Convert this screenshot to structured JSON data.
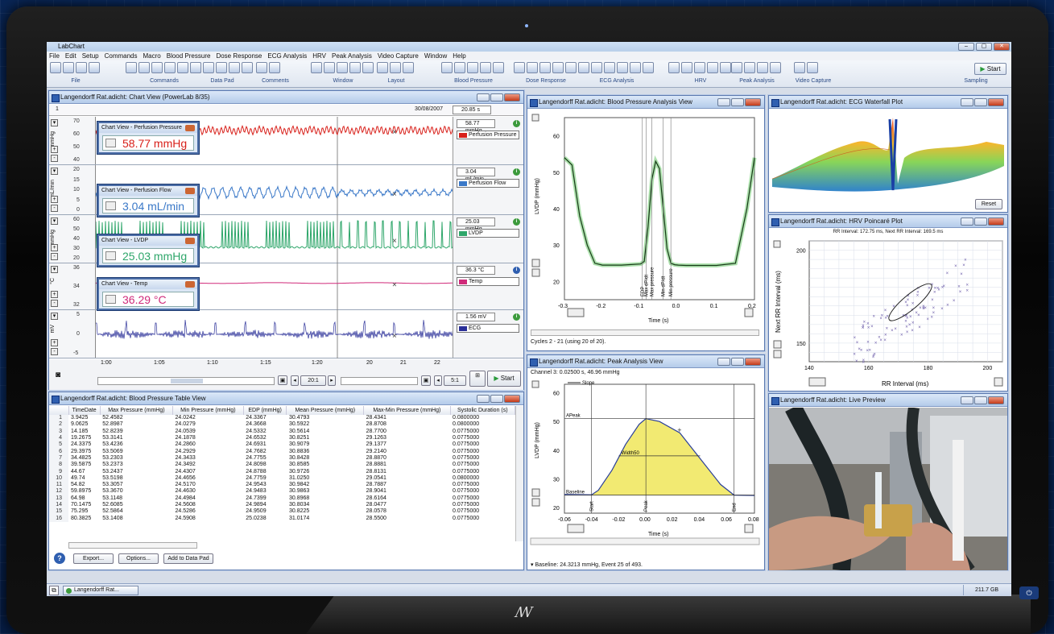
{
  "app": {
    "title": "LabChart"
  },
  "menu": [
    "File",
    "Edit",
    "Setup",
    "Commands",
    "Macro",
    "Blood Pressure",
    "Dose Response",
    "ECG Analysis",
    "HRV",
    "Peak Analysis",
    "Video Capture",
    "Window",
    "Help"
  ],
  "toolbar_groups": [
    "File",
    "Commands",
    "Data Pad",
    "Comments",
    "Window",
    "Layout",
    "Blood Pressure",
    "Dose Response",
    "ECG Analysis",
    "HRV",
    "Peak Analysis",
    "Video Capture",
    "Sampling"
  ],
  "toolbar_start": "Start",
  "chart_view": {
    "title": "Langendorff Rat.adicht: Chart View (PowerLab 8/35)",
    "comment_marker": "1",
    "date": "30/08/2007",
    "duration": "20.85 s",
    "time_ticks": [
      "1:00",
      "1:05",
      "1:10",
      "1:15",
      "1:20",
      "20",
      "21",
      "22"
    ],
    "zoom1": "20:1",
    "zoom2": "5:1",
    "start": "Start",
    "channels": [
      {
        "name": "Perfusion Pressure",
        "unit": "mmHg",
        "value": "58.77 mmHg",
        "color": "#d8201a",
        "ticks": [
          "70",
          "60",
          "50",
          "40"
        ],
        "popup_title": "Chart View - Perfusion Pressure",
        "popup_value": "58.77 mmHg"
      },
      {
        "name": "Perfusion Flow",
        "unit": "mL/min",
        "value": "3.04 mL/min",
        "color": "#3a78c8",
        "ticks": [
          "20",
          "15",
          "10",
          "5",
          "0"
        ],
        "popup_title": "Chart View - Perfusion Flow",
        "popup_value": "3.04 mL/min"
      },
      {
        "name": "LVDP",
        "unit": "mmHg",
        "value": "25.03 mmHg",
        "color": "#2ea66a",
        "ticks": [
          "60",
          "50",
          "40",
          "30",
          "20"
        ],
        "popup_title": "Chart View - LVDP",
        "popup_value": "25.03 mmHg"
      },
      {
        "name": "Temp",
        "unit": "°C",
        "value": "36.3 °C",
        "color": "#d02a7a",
        "ticks": [
          "36",
          "34",
          "32"
        ],
        "popup_title": "Chart View - Temp",
        "popup_value": "36.29 °C"
      },
      {
        "name": "ECG",
        "unit": "mV",
        "value": "1.56 mV",
        "color": "#2a2f98",
        "ticks": [
          "5",
          "0",
          "-5"
        ]
      }
    ]
  },
  "bp_table": {
    "title": "Langendorff Rat.adicht: Blood Pressure Table View",
    "columns": [
      "TimeDate",
      "Max Pressure (mmHg)",
      "Min Pressure (mmHg)",
      "EDP (mmHg)",
      "Mean Pressure (mmHg)",
      "Max-Min Pressure (mmHg)",
      "Systolic Duration (s)"
    ],
    "rows": [
      [
        "1",
        "3.9425",
        "52.4582",
        "24.0242",
        "24.3367",
        "30.4793",
        "28.4341",
        "0.0800000"
      ],
      [
        "2",
        "9.0625",
        "52.8987",
        "24.0279",
        "24.3668",
        "30.5922",
        "28.8708",
        "0.0800000"
      ],
      [
        "3",
        "14.185",
        "52.8239",
        "24.0539",
        "24.5332",
        "30.5614",
        "28.7700",
        "0.0775000"
      ],
      [
        "4",
        "19.2675",
        "53.3141",
        "24.1878",
        "24.6532",
        "30.8251",
        "29.1263",
        "0.0775000"
      ],
      [
        "5",
        "24.3375",
        "53.4236",
        "24.2860",
        "24.6931",
        "30.9079",
        "29.1377",
        "0.0775000"
      ],
      [
        "6",
        "29.3975",
        "53.5069",
        "24.2929",
        "24.7682",
        "30.8836",
        "29.2140",
        "0.0775000"
      ],
      [
        "7",
        "34.4825",
        "53.2303",
        "24.3433",
        "24.7755",
        "30.8428",
        "28.8870",
        "0.0775000"
      ],
      [
        "8",
        "39.5875",
        "53.2373",
        "24.3492",
        "24.8098",
        "30.8585",
        "28.8881",
        "0.0775000"
      ],
      [
        "9",
        "44.67",
        "53.2437",
        "24.4307",
        "24.8788",
        "30.9726",
        "28.8131",
        "0.0775000"
      ],
      [
        "10",
        "49.74",
        "53.5198",
        "24.4656",
        "24.7759",
        "31.0250",
        "29.0541",
        "0.0800000"
      ],
      [
        "11",
        "54.82",
        "53.3057",
        "24.5170",
        "24.9543",
        "30.9842",
        "28.7887",
        "0.0775000"
      ],
      [
        "12",
        "59.8975",
        "53.3670",
        "24.4630",
        "24.9483",
        "30.9863",
        "28.9041",
        "0.0775000"
      ],
      [
        "13",
        "64.98",
        "53.1148",
        "24.4984",
        "24.7399",
        "30.8968",
        "28.6164",
        "0.0775000"
      ],
      [
        "14",
        "70.1475",
        "52.6085",
        "24.5608",
        "24.9894",
        "30.8034",
        "28.0477",
        "0.0775000"
      ],
      [
        "15",
        "75.295",
        "52.5864",
        "24.5286",
        "24.9509",
        "30.8225",
        "28.0578",
        "0.0775000"
      ],
      [
        "16",
        "80.3825",
        "53.1408",
        "24.5908",
        "25.0238",
        "31.0174",
        "28.5500",
        "0.0775000"
      ]
    ],
    "buttons": [
      "Export...",
      "Options...",
      "Add to Data Pad"
    ]
  },
  "bp_analysis": {
    "title": "Langendorff Rat.adicht: Blood Pressure Analysis View",
    "ylabel": "LVDP (mmHg)",
    "xlabel": "Time (s)",
    "yticks": [
      "60",
      "50",
      "40",
      "30",
      "20"
    ],
    "xticks": [
      "-0.3",
      "-0.2",
      "-0.1",
      "0.0",
      "0.1",
      "0.2"
    ],
    "markers": [
      "EDP",
      "Max dP/dt",
      "Max pressure",
      "Min dP/dt",
      "Min pressure"
    ],
    "status": "Cycles 2 - 21 (using 20 of 20)."
  },
  "peak_analysis": {
    "title": "Langendorff Rat.adicht: Peak Analysis View",
    "channel_info": "Channel 3: 0.02500 s, 46.96 mmHg",
    "legend": "Slope",
    "ylabel": "LVDP (mmHg)",
    "xlabel": "Time (s)",
    "yticks": [
      "60",
      "50",
      "40",
      "30",
      "20"
    ],
    "xticks": [
      "-0.06",
      "-0.04",
      "-0.02",
      "0.00",
      "0.02",
      "0.04",
      "0.06",
      "0.08"
    ],
    "labels": {
      "apeak": "APeak",
      "width": "Width50",
      "baseline": "Baseline",
      "start": "Start",
      "peak": "Peak",
      "end": "End"
    },
    "status": "Baseline: 24.3213 mmHg, Event 25 of 493."
  },
  "ecg_waterfall": {
    "title": "Langendorff Rat.adicht: ECG Waterfall Plot",
    "reset": "Reset"
  },
  "hrv": {
    "title": "Langendorff Rat.adicht: HRV Poincaré Plot",
    "info": "RR Interval: 172.75 ms, Next RR Interval: 169.5 ms",
    "ylabel": "Next RR Interval (ms)",
    "xlabel": "RR Interval (ms)",
    "yticks": [
      "200",
      "150"
    ],
    "xticks": [
      "140",
      "160",
      "180",
      "200"
    ]
  },
  "live_preview": {
    "title": "Langendorff Rat.adicht: Live Preview"
  },
  "taskbar": {
    "item": "Langendorff Rat...",
    "disk": "211.7 GB"
  }
}
